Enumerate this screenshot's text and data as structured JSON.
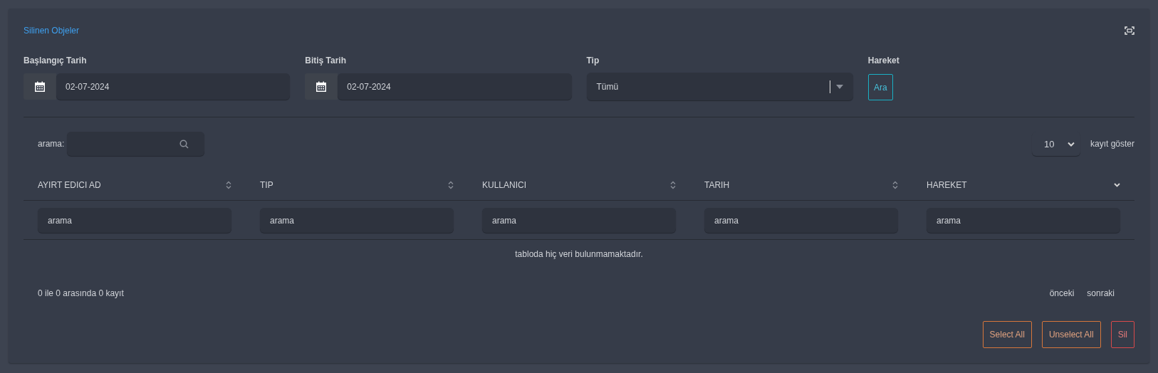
{
  "title": "Silinen Objeler",
  "filters": [
    {
      "label": "Başlangıç Tarih",
      "kind": "date",
      "value": "02-07-2024"
    },
    {
      "label": "Bitiş Tarih",
      "kind": "date",
      "value": "02-07-2024"
    },
    {
      "label": "Tip",
      "kind": "select",
      "value": "Tümü"
    },
    {
      "label": "Hareket",
      "kind": "button",
      "value": "Ara"
    }
  ],
  "search": {
    "label": "arama:"
  },
  "page_size": {
    "value": "10",
    "label": "kayıt göster"
  },
  "table": {
    "columns": [
      {
        "label": "AYIRT EDICI AD",
        "sorted": false,
        "filter_placeholder": "arama"
      },
      {
        "label": "TIP",
        "sorted": false,
        "filter_placeholder": "arama"
      },
      {
        "label": "KULLANICI",
        "sorted": false,
        "filter_placeholder": "arama"
      },
      {
        "label": "TARIH",
        "sorted": false,
        "filter_placeholder": "arama"
      },
      {
        "label": "HAREKET",
        "sorted": true,
        "filter_placeholder": "arama"
      }
    ],
    "empty_message": "tabloda hiç veri bulunmamaktadır."
  },
  "info": "0 ile 0 arasında 0 kayıt",
  "pagination": [
    "önceki",
    "sonraki"
  ],
  "actions": [
    {
      "label": "Select All",
      "kind": "warning"
    },
    {
      "label": "Unselect All",
      "kind": "warning"
    },
    {
      "label": "Sil",
      "kind": "danger"
    }
  ]
}
